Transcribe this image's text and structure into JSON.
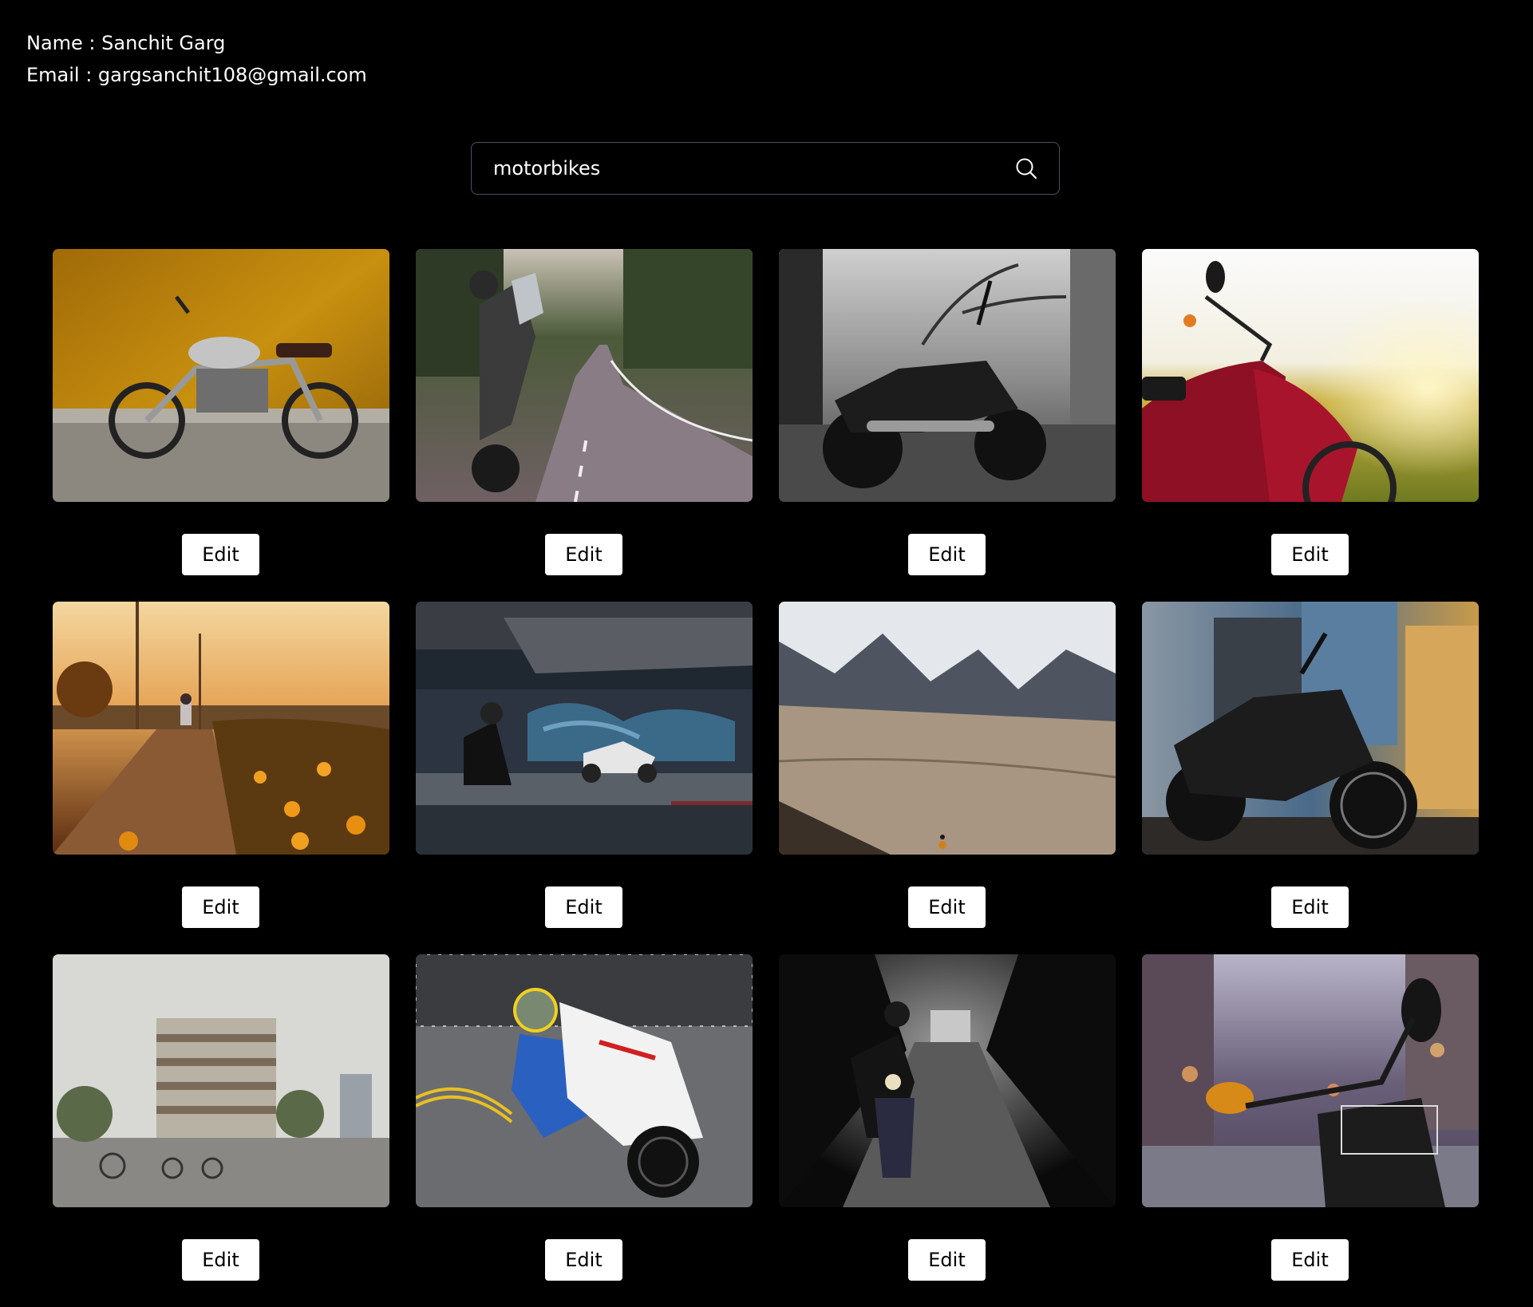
{
  "user": {
    "name_line": "Name : Sanchit Garg",
    "email_line": "Email : gargsanchit108@gmail.com"
  },
  "search": {
    "value": "motorbikes",
    "icon": "search-icon"
  },
  "images": [
    {
      "name": "image-royal-enfield-yellow-wall",
      "edit_label": "Edit"
    },
    {
      "name": "image-adventure-bike-road",
      "edit_label": "Edit"
    },
    {
      "name": "image-cruiser-black-white",
      "edit_label": "Edit"
    },
    {
      "name": "image-red-scooter-field",
      "edit_label": "Edit"
    },
    {
      "name": "image-rider-sunset-flowers",
      "edit_label": "Edit"
    },
    {
      "name": "image-rider-graffiti-underpass",
      "edit_label": "Edit"
    },
    {
      "name": "image-mountain-road-rider",
      "edit_label": "Edit"
    },
    {
      "name": "image-black-cruiser-city",
      "edit_label": "Edit"
    },
    {
      "name": "image-city-traffic-building",
      "edit_label": "Edit"
    },
    {
      "name": "image-racing-bike-corner",
      "edit_label": "Edit"
    },
    {
      "name": "image-rider-tree-tunnel",
      "edit_label": "Edit"
    },
    {
      "name": "image-scooter-city-street",
      "edit_label": "Edit"
    }
  ]
}
